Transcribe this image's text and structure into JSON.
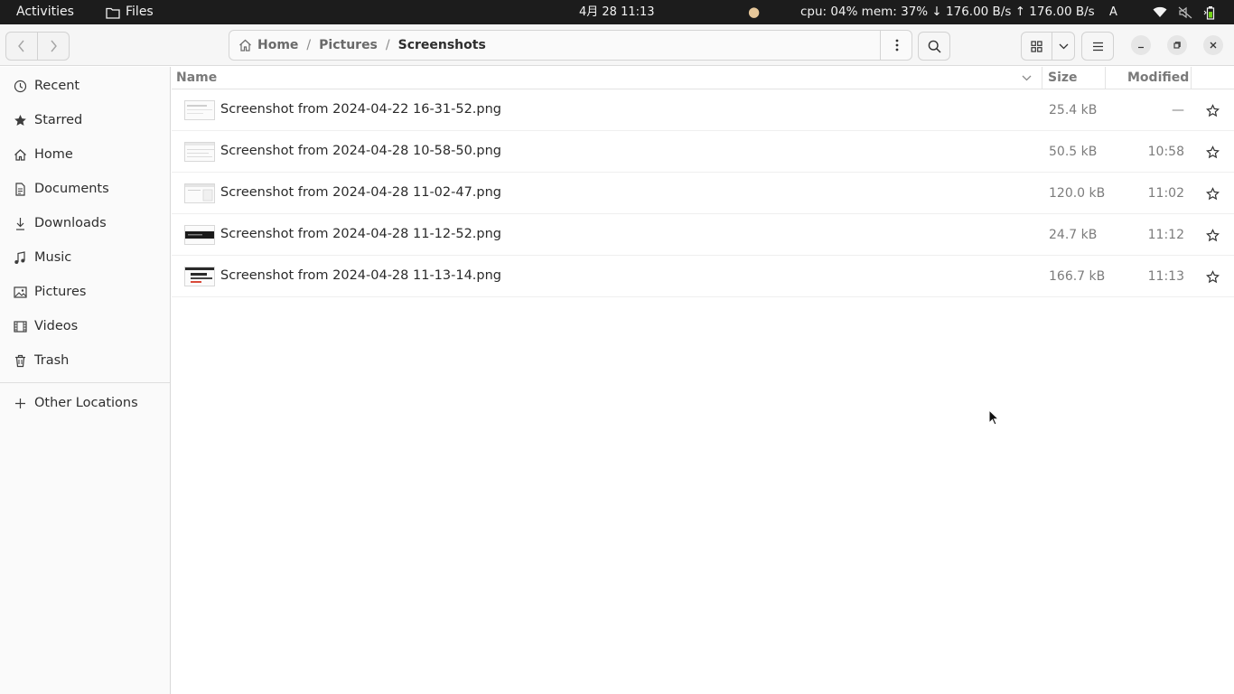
{
  "topbar": {
    "activities": "Activities",
    "app_name": "Files",
    "clock": "4月 28  11:13",
    "system_stats": "cpu: 04% mem: 37% ↓  176.00 B/s ↑  176.00 B/s",
    "input_method": "A"
  },
  "header": {
    "path": {
      "home": "Home",
      "parent": "Pictures",
      "current": "Screenshots",
      "separator": "/"
    }
  },
  "sidebar": {
    "items": [
      {
        "label": "Recent",
        "icon": "clock-icon"
      },
      {
        "label": "Starred",
        "icon": "star-icon"
      },
      {
        "label": "Home",
        "icon": "home-icon"
      },
      {
        "label": "Documents",
        "icon": "document-icon"
      },
      {
        "label": "Downloads",
        "icon": "download-icon"
      },
      {
        "label": "Music",
        "icon": "music-icon"
      },
      {
        "label": "Pictures",
        "icon": "picture-icon"
      },
      {
        "label": "Videos",
        "icon": "video-icon"
      },
      {
        "label": "Trash",
        "icon": "trash-icon"
      }
    ],
    "other_locations": "Other Locations"
  },
  "list": {
    "columns": {
      "name": "Name",
      "size": "Size",
      "modified": "Modified"
    },
    "files": [
      {
        "name": "Screenshot from 2024-04-22 16-31-52.png",
        "size": "25.4 kB",
        "modified": "—"
      },
      {
        "name": "Screenshot from 2024-04-28 10-58-50.png",
        "size": "50.5 kB",
        "modified": "10:58"
      },
      {
        "name": "Screenshot from 2024-04-28 11-02-47.png",
        "size": "120.0 kB",
        "modified": "11:02"
      },
      {
        "name": "Screenshot from 2024-04-28 11-12-52.png",
        "size": "24.7 kB",
        "modified": "11:12"
      },
      {
        "name": "Screenshot from 2024-04-28 11-13-14.png",
        "size": "166.7 kB",
        "modified": "11:13"
      }
    ]
  }
}
